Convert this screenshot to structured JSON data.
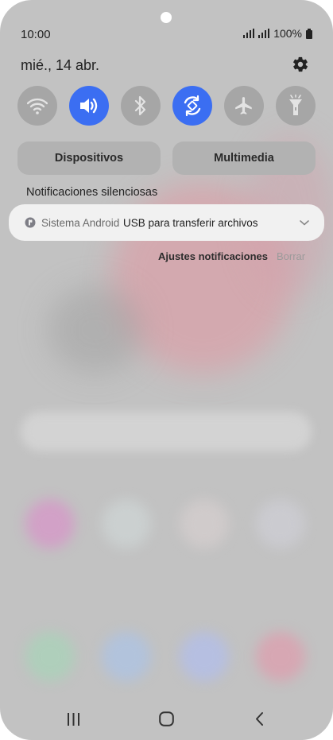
{
  "status_bar": {
    "time": "10:00",
    "battery_text": "100%",
    "icons": [
      "signal-icon",
      "signal-icon",
      "battery-icon"
    ]
  },
  "header": {
    "date": "mié., 14 abr.",
    "settings_icon": "gear-icon"
  },
  "quick_toggles": [
    {
      "name": "wifi",
      "icon": "wifi-icon",
      "state": "off"
    },
    {
      "name": "sound",
      "icon": "speaker-icon",
      "state": "on"
    },
    {
      "name": "bluetooth",
      "icon": "bluetooth-icon",
      "state": "off"
    },
    {
      "name": "auto-rotate",
      "icon": "rotate-icon",
      "state": "on"
    },
    {
      "name": "airplane",
      "icon": "airplane-icon",
      "state": "off"
    },
    {
      "name": "flashlight",
      "icon": "flashlight-icon",
      "state": "off"
    }
  ],
  "panel_buttons": {
    "devices_label": "Dispositivos",
    "media_label": "Multimedia"
  },
  "notifications": {
    "section_title": "Notificaciones silenciosas",
    "items": [
      {
        "app": "Sistema Android",
        "text": "USB para transferir archivos"
      }
    ],
    "settings_label": "Ajustes notificaciones",
    "clear_label": "Borrar"
  },
  "colors": {
    "accent": "#3b6ef2",
    "toggle_off": "#a6a6a6",
    "panel_bg": "#c2c2c2",
    "notification_bg": "#f1f1f1"
  },
  "nav_bar": {
    "icons": [
      "recents-icon",
      "home-icon",
      "back-icon"
    ]
  }
}
